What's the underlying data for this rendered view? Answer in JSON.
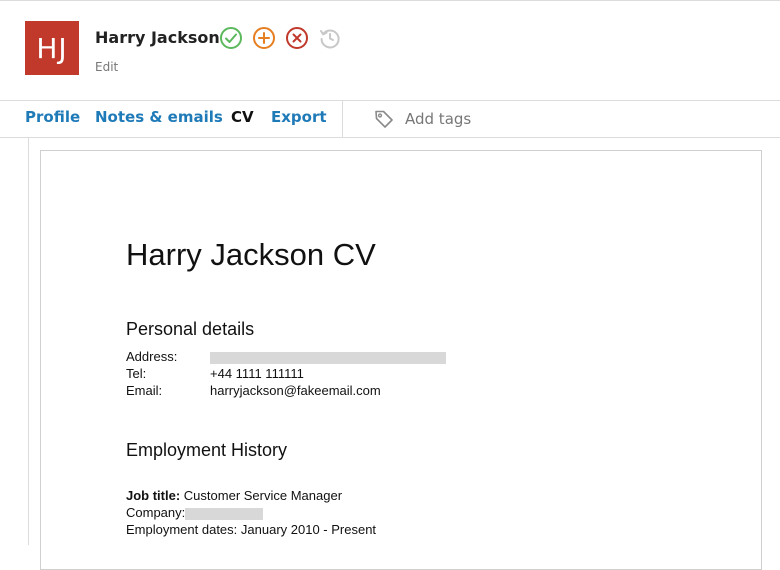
{
  "header": {
    "avatar_initials": "HJ",
    "name": "Harry Jackson",
    "edit_label": "Edit",
    "colors": {
      "avatar": "#c0392b",
      "approve": "#5cb85c",
      "add": "#e67e22",
      "reject": "#c0392b",
      "history": "#c8c8c8"
    }
  },
  "tabs": [
    {
      "label": "Profile"
    },
    {
      "label": "Notes & emails"
    },
    {
      "label": "CV"
    },
    {
      "label": "Export"
    }
  ],
  "tags": {
    "placeholder": "Add tags",
    "icon": "tag-icon"
  },
  "cv": {
    "title": "Harry Jackson CV",
    "personal_heading": "Personal details",
    "address_label": "Address:",
    "tel_label": "Tel:",
    "tel_value": "+44 1111 111111",
    "email_label": "Email:",
    "email_value": "harryjackson@fakeemail.com",
    "employment_heading": "Employment History",
    "job_title_label": "Job title:",
    "job_title_value": "Customer Service Manager",
    "company_label": "Company:",
    "dates_label": "Employment dates:",
    "dates_value": "January 2010 - Present"
  }
}
